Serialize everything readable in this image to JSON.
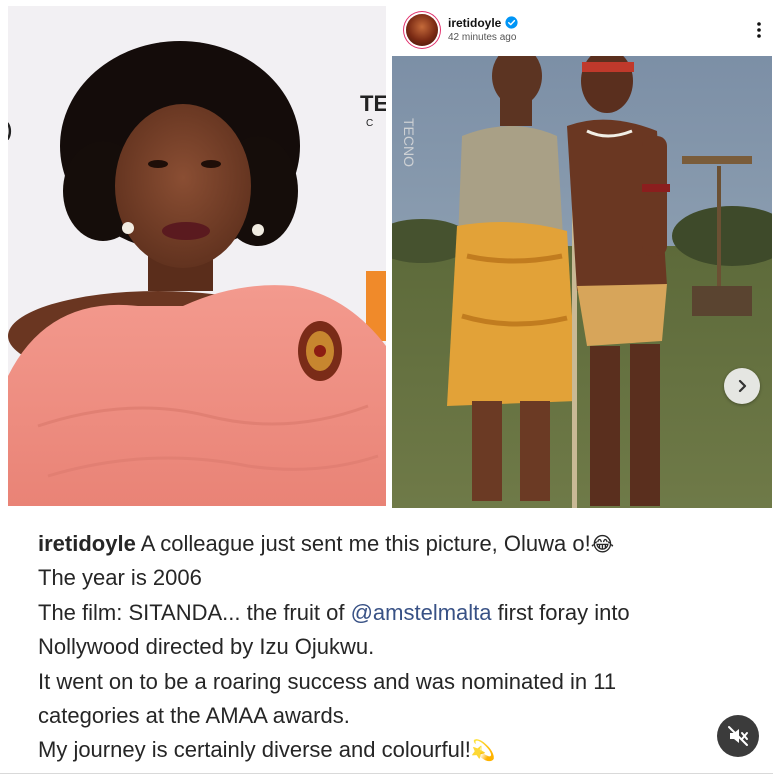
{
  "post": {
    "username": "iretidoyle",
    "timestamp": "42 minutes ago",
    "verified": true,
    "left_photo_watermark": "TE C",
    "right_photo_watermark": "TECNO"
  },
  "caption": {
    "username": "iretidoyle",
    "line1_text": " A colleague just sent me this picture, Oluwa o!",
    "line1_emoji": "😂",
    "line2": "The year is 2006",
    "line3_before": "The film: SITANDA... the fruit of ",
    "line3_mention": "@amstelmalta",
    "line3_after": " first foray into",
    "line4": "Nollywood directed by Izu Ojukwu.",
    "line5": "It went on to be a roaring success and was nominated in 11",
    "line6": "categories at the AMAA awards.",
    "line7_text": "My journey is certainly diverse and colourful!",
    "line7_emoji": "💫"
  },
  "icons": {
    "verified": "verified-badge-icon",
    "more": "more-options-icon",
    "next": "chevron-right-icon",
    "mute": "muted-speaker-icon"
  },
  "colors": {
    "mention": "#385185",
    "verified_blue": "#0095f6",
    "text": "#262626",
    "dress_coral": "#ef8e82"
  }
}
